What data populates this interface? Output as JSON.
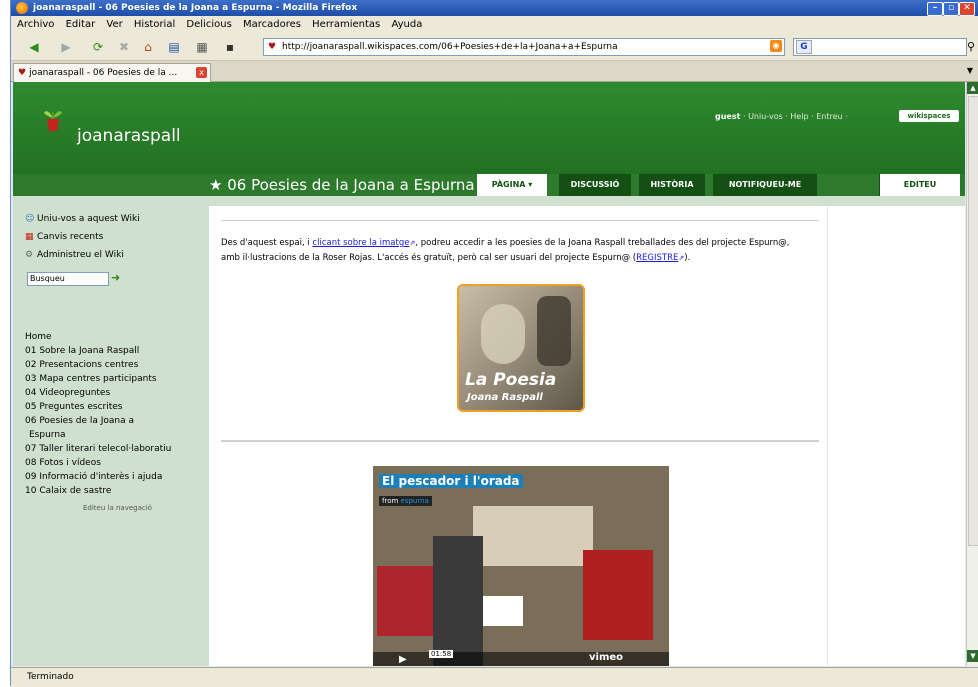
{
  "window": {
    "title": "joanaraspall - 06 Poesies de la Joana a Espurna - Mozilla Firefox",
    "min_label": "–",
    "max_label": "▫",
    "close_label": "✕"
  },
  "menu": [
    "Archivo",
    "Editar",
    "Ver",
    "Historial",
    "Delicious",
    "Marcadores",
    "Herramientas",
    "Ayuda"
  ],
  "nav": {
    "url": "http://joanaraspall.wikispaces.com/06+Poesies+de+la+Joana+a+Espurna",
    "search_engine": "G",
    "back_icon": "◀",
    "forward_icon": "▶",
    "reload_icon": "⟳",
    "stop_icon": "✖",
    "home_icon": "⌂",
    "bookmark_icon": "▤",
    "print_icon": "▦",
    "save_icon": "▪",
    "rss_icon": "◉",
    "go_icon": "⚲"
  },
  "tab": {
    "label": "joanaraspall - 06 Poesies de la ...",
    "close": "x"
  },
  "site": {
    "name": "joanaraspall",
    "toplinks": {
      "guest": "guest",
      "rest": "· Uniu-vos · Help · Entreu ·"
    },
    "wikispaces_label": "wikispaces",
    "page_title": "★ 06 Poesies de la Joana a Espurna",
    "tabs": {
      "pagina": "PÀGINA ▾",
      "discussio": "DISCUSSIÓ",
      "historia": "HISTÒRIA",
      "notifiqueu": "NOTIFIQUEU-ME"
    },
    "edit_label": "EDITEU"
  },
  "sidebar": {
    "actions": {
      "join": "Uniu-vos a aquest Wiki",
      "changes": "Canvis recents",
      "admin": "Administreu el Wiki"
    },
    "search_value": "Busqueu",
    "nav_items": [
      "Home",
      "01 Sobre la Joana Raspall",
      "02 Presentacions centres",
      "03 Mapa centres participants",
      "04 Videopreguntes",
      "05 Preguntes escrites",
      "06 Poesies de la Joana a",
      "Espurna",
      "07 Taller literari telecol·laboratiu",
      "08 Fotos i vídeos",
      "09 Informació d'interès i ajuda",
      "10 Calaix de sastre"
    ],
    "edit_nav": "Editeu la navegació"
  },
  "content": {
    "intro_a": "Des d'aquest espai, i ",
    "intro_link1": "clicant sobre la imatge",
    "intro_b": ", podreu accedir a les poesies de la Joana Raspall treballades des del projecte Espurn@, amb il·lustracions de la Roser Rojas. L'accés és gratuït, però cal ser usuari del projecte Espurn@ (",
    "intro_link2": "REGISTRE",
    "intro_c": ").",
    "poesia_line1": "La Poesia",
    "poesia_line2": "Joana Raspall",
    "video": {
      "title": "El pescador i l'orada",
      "from": "from",
      "from_user": "espurna",
      "time": "01:58",
      "brand": "vimeo"
    }
  },
  "status": {
    "text": "Terminado"
  },
  "colors": {
    "header_green": "#2f8a2f",
    "tab_dark": "#145014",
    "sidebar_bg": "#cfe0cf",
    "accent_orange": "#f0a020",
    "link_blue": "#1a1ae0"
  }
}
